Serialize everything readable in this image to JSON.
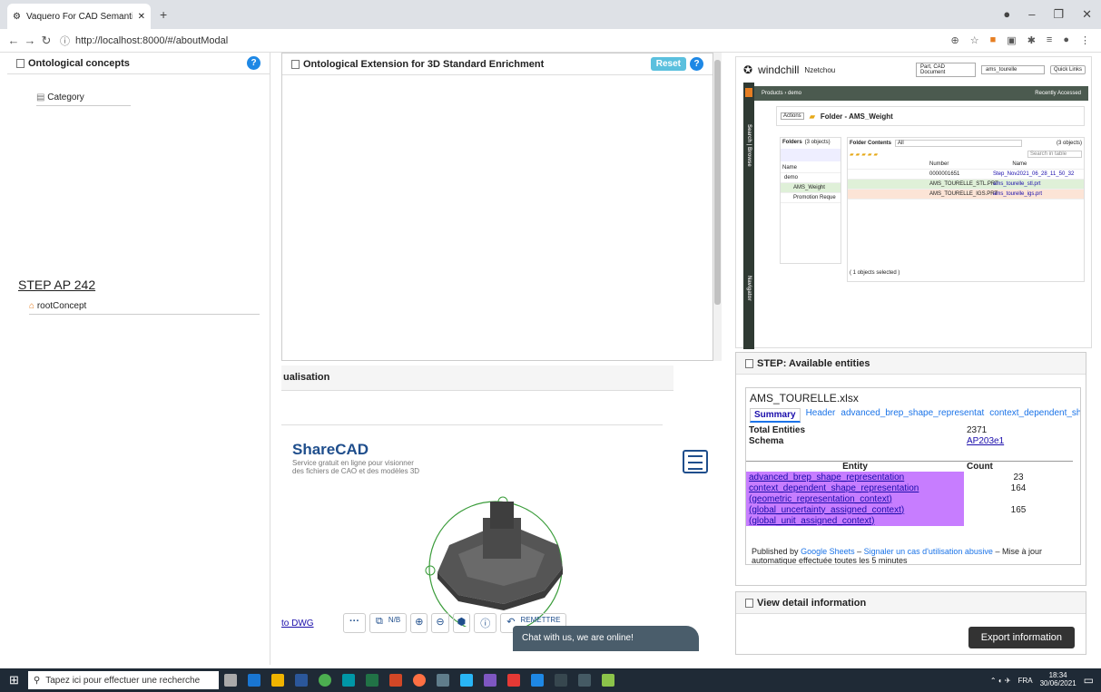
{
  "browser": {
    "tab_title": "Vaquero For CAD Semantic Enric",
    "url": "http://localhost:8000/#/aboutModal",
    "new_tab_symbol": "+"
  },
  "left_panel": {
    "title": "Ontological concepts",
    "category_label": "Category",
    "step_title": "STEP AP 242",
    "root_concept": "rootConcept"
  },
  "center_panel": {
    "title": "Ontological Extension for 3D Standard Enrichment",
    "reset_label": "Reset",
    "visualisation_label": "ualisation"
  },
  "sharecad": {
    "logo": "ShareCAD",
    "tagline": "Service gratuit en ligne pour visionner des fichiers de CAO et des modèles 3D",
    "dwg_link": "to DWG",
    "nb_label": "N/B",
    "remettre_label": "REMETTRE",
    "chat_text": "Chat with us, we are online!"
  },
  "windchill": {
    "brand": "windchill",
    "user": "Nzetchou",
    "search_type": "Part, CAD Document",
    "search_value": "ams_tourelle",
    "quick_links": "Quick Links",
    "breadcrumb": "Products › demo",
    "recently": "Recently Accessed",
    "folder_title": "Folder - AMS_Weight",
    "actions": "Actions",
    "folders_label": "Folders",
    "folders_count": "(3 objects)",
    "folder_contents": "Folder Contents",
    "all": "All",
    "objects_count": "(3 objects)",
    "search_in_table": "Search in table",
    "col_name": "Name",
    "col_number": "Number",
    "tree": [
      "demo",
      "AMS_Weight",
      "Promotion Reque"
    ],
    "rows": [
      {
        "number": "0000001651",
        "name": "Step_Nov2021_06_28_11_50_32"
      },
      {
        "number": "AMS_TOURELLE_STL.PRT",
        "name": "ams_tourelle_stl.prt"
      },
      {
        "number": "AMS_TOURELLE_IGS.PRT",
        "name": "ams_tourelle_igs.prt"
      }
    ],
    "selected": "( 1 objects selected )",
    "side_search": "Search | Browse",
    "side_nav": "Navigator"
  },
  "step_panel": {
    "title": "STEP: Available entities",
    "file": "AMS_TOURELLE.xlsx",
    "tabs": [
      "Summary",
      "Header",
      "advanced_brep_shape_representat",
      "context_dependent_shape_rep"
    ],
    "total_label": "Total Entities",
    "total_value": "2371",
    "schema_label": "Schema",
    "schema_value": "AP203e1",
    "col_entity": "Entity",
    "col_count": "Count",
    "entities": [
      {
        "name": "advanced_brep_shape_representation",
        "count": "23"
      },
      {
        "name": "context_dependent_shape_representation",
        "count": "164"
      },
      {
        "name": "(geometric_representation_context)",
        "count": ""
      },
      {
        "name": "(global_uncertainty_assigned_context)",
        "count": "165"
      },
      {
        "name": "(global_unit_assigned_context)",
        "count": ""
      }
    ],
    "published_prefix": "Published by",
    "published_by": "Google Sheets",
    "report": "Signaler un cas d'utilisation abusive",
    "update_text": "– Mise à jour automatique effectuée toutes les 5 minutes"
  },
  "detail_panel": {
    "title": "View detail information",
    "export_label": "Export information"
  },
  "taskbar": {
    "search_placeholder": "Tapez ici pour effectuer une recherche",
    "lang": "FRA",
    "time": "18:34",
    "date": "30/06/2021"
  }
}
